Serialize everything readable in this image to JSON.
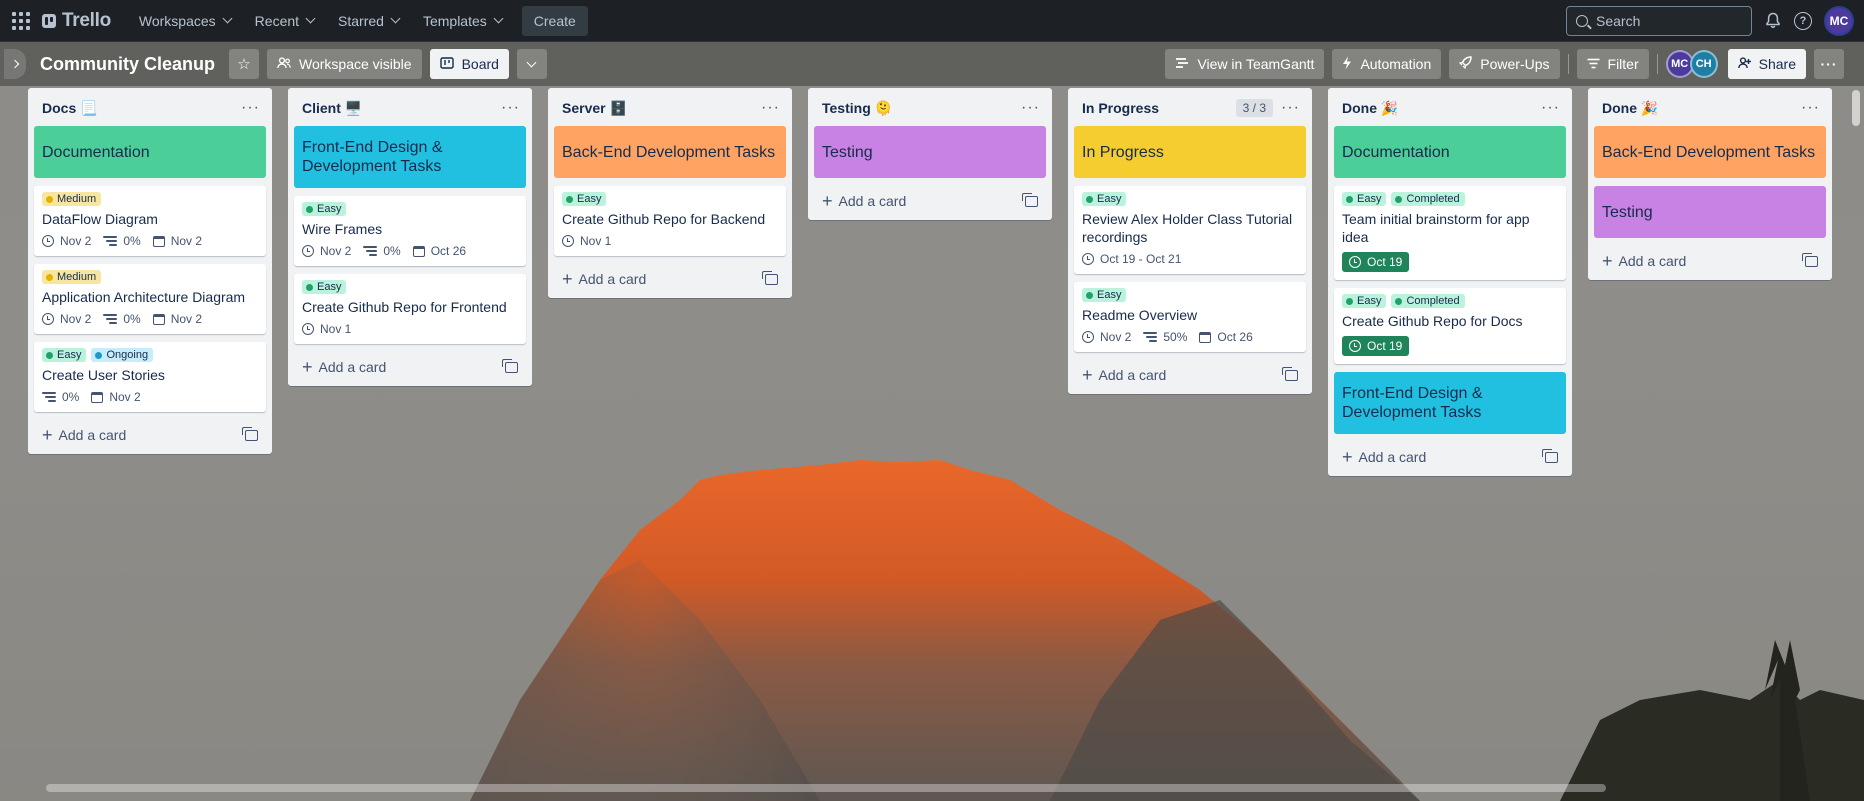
{
  "nav": {
    "logo": "Trello",
    "items": [
      {
        "label": "Workspaces"
      },
      {
        "label": "Recent"
      },
      {
        "label": "Starred"
      },
      {
        "label": "Templates"
      }
    ],
    "create_label": "Create",
    "search_placeholder": "Search",
    "user_initials": "MC"
  },
  "board": {
    "title": "Community Cleanup",
    "visibility_label": "Workspace visible",
    "view_label": "Board",
    "teamgantt_label": "View in TeamGantt",
    "automation_label": "Automation",
    "powerups_label": "Power-Ups",
    "filter_label": "Filter",
    "members": [
      {
        "initials": "MC",
        "color": "#4c3a9e"
      },
      {
        "initials": "CH",
        "color": "#1d7fa5"
      }
    ],
    "share_label": "Share"
  },
  "lists": [
    {
      "title": "Docs 📃",
      "cover": {
        "text": "Documentation",
        "color": "#4bce97"
      },
      "cards": [
        {
          "labels": [
            {
              "text": "Medium",
              "bg": "#f8e6a0",
              "dot": "#e2b203"
            }
          ],
          "title": "DataFlow Diagram",
          "badges": [
            {
              "kind": "clock",
              "text": "Nov 2"
            },
            {
              "kind": "checklist",
              "text": "0%"
            },
            {
              "kind": "cal",
              "text": "Nov 2"
            }
          ]
        },
        {
          "labels": [
            {
              "text": "Medium",
              "bg": "#f8e6a0",
              "dot": "#e2b203"
            }
          ],
          "title": "Application Architecture Diagram",
          "badges": [
            {
              "kind": "clock",
              "text": "Nov 2"
            },
            {
              "kind": "checklist",
              "text": "0%"
            },
            {
              "kind": "cal",
              "text": "Nov 2"
            }
          ]
        },
        {
          "labels": [
            {
              "text": "Easy",
              "bg": "#baf3db",
              "dot": "#22a06b"
            },
            {
              "text": "Ongoing",
              "bg": "#c6edfb",
              "dot": "#1d9aca"
            }
          ],
          "title": "Create User Stories",
          "badges": [
            {
              "kind": "checklist",
              "text": "0%"
            },
            {
              "kind": "cal",
              "text": "Nov 2"
            }
          ]
        }
      ],
      "add_label": "Add a card"
    },
    {
      "title": "Client 🖥️",
      "cover": {
        "text": "Front-End Design & Development Tasks",
        "color": "#22c0e0"
      },
      "cards": [
        {
          "labels": [
            {
              "text": "Easy",
              "bg": "#baf3db",
              "dot": "#22a06b"
            }
          ],
          "title": "Wire Frames",
          "badges": [
            {
              "kind": "clock",
              "text": "Nov 2"
            },
            {
              "kind": "checklist",
              "text": "0%"
            },
            {
              "kind": "cal",
              "text": "Oct 26"
            }
          ]
        },
        {
          "labels": [
            {
              "text": "Easy",
              "bg": "#baf3db",
              "dot": "#22a06b"
            }
          ],
          "title": "Create Github Repo for Frontend",
          "badges": [
            {
              "kind": "clock",
              "text": "Nov 1"
            }
          ]
        }
      ],
      "add_label": "Add a card"
    },
    {
      "title": "Server 🗄️",
      "cover": {
        "text": "Back-End Development Tasks",
        "color": "#fea362"
      },
      "cards": [
        {
          "labels": [
            {
              "text": "Easy",
              "bg": "#baf3db",
              "dot": "#22a06b"
            }
          ],
          "title": "Create Github Repo for Backend",
          "badges": [
            {
              "kind": "clock",
              "text": "Nov 1"
            }
          ]
        }
      ],
      "add_label": "Add a card"
    },
    {
      "title": "Testing 🫠",
      "cover": {
        "text": "Testing",
        "color": "#c782e3"
      },
      "cards": [],
      "add_label": "Add a card"
    },
    {
      "title": "In Progress",
      "count": "3 / 3",
      "cover": {
        "text": "In Progress",
        "color": "#f5cd2f"
      },
      "cards": [
        {
          "labels": [
            {
              "text": "Easy",
              "bg": "#baf3db",
              "dot": "#22a06b"
            }
          ],
          "title": "Review Alex Holder Class Tutorial recordings",
          "badges": [
            {
              "kind": "clock",
              "text": "Oct 19 - Oct 21"
            }
          ]
        },
        {
          "labels": [
            {
              "text": "Easy",
              "bg": "#baf3db",
              "dot": "#22a06b"
            }
          ],
          "title": "Readme Overview",
          "badges": [
            {
              "kind": "clock",
              "text": "Nov 2"
            },
            {
              "kind": "checklist",
              "text": "50%"
            },
            {
              "kind": "cal",
              "text": "Oct 26"
            }
          ]
        }
      ],
      "add_label": "Add a card"
    },
    {
      "title": "Done 🎉",
      "cover": {
        "text": "Documentation",
        "color": "#4bce97"
      },
      "cards": [
        {
          "labels": [
            {
              "text": "Easy",
              "bg": "#baf3db",
              "dot": "#22a06b"
            },
            {
              "text": "Completed",
              "bg": "#baf3db",
              "dot": "#22a06b"
            }
          ],
          "title": "Team initial brainstorm for app idea",
          "badges": [
            {
              "kind": "due-done",
              "text": "Oct 19"
            }
          ]
        },
        {
          "labels": [
            {
              "text": "Easy",
              "bg": "#baf3db",
              "dot": "#22a06b"
            },
            {
              "text": "Completed",
              "bg": "#baf3db",
              "dot": "#22a06b"
            }
          ],
          "title": "Create Github Repo for Docs",
          "badges": [
            {
              "kind": "due-done",
              "text": "Oct 19"
            }
          ]
        }
      ],
      "trailing_cover": {
        "text": "Front-End Design & Development Tasks",
        "color": "#22c0e0"
      },
      "add_label": "Add a card"
    },
    {
      "title": "Done 🎉",
      "cover": {
        "text": "Back-End Development Tasks",
        "color": "#fea362"
      },
      "cards": [],
      "trailing_cover": {
        "text": "Testing",
        "color": "#c782e3"
      },
      "add_label": "Add a card"
    }
  ]
}
